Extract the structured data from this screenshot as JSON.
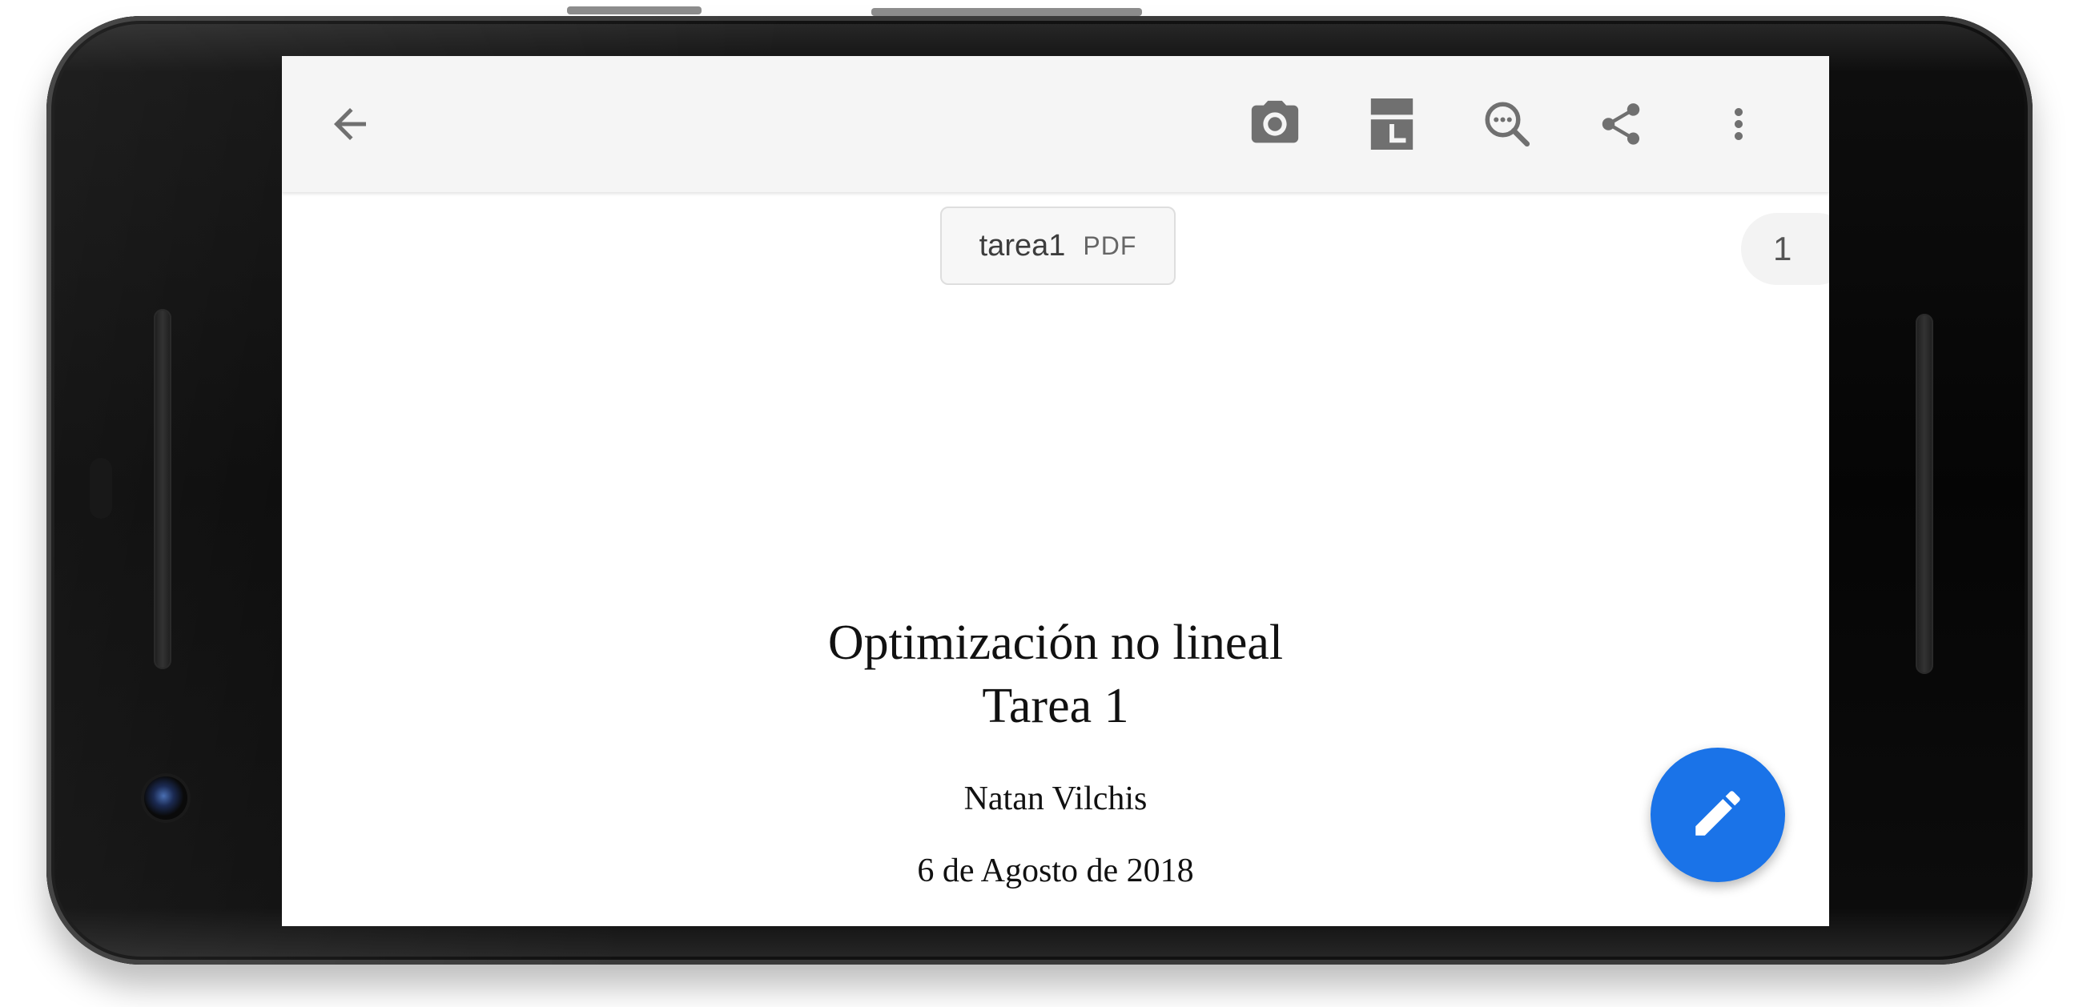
{
  "toolbar": {
    "icons": [
      "back-arrow-icon",
      "camera-icon",
      "split-page-icon",
      "find-in-page-icon",
      "share-icon",
      "more-vert-icon"
    ]
  },
  "document": {
    "name": "tarea1",
    "type": "PDF",
    "page_number": "1",
    "title": "Optimización no lineal",
    "subtitle": "Tarea 1",
    "author": "Natan Vilchis",
    "date": "6 de Agosto de 2018"
  },
  "fab": {
    "icon": "edit-pencil-icon",
    "color": "#1a73e8"
  },
  "colors": {
    "toolbar_bg": "#f5f5f5",
    "icon_gray": "#707070",
    "accent": "#1a73e8"
  }
}
